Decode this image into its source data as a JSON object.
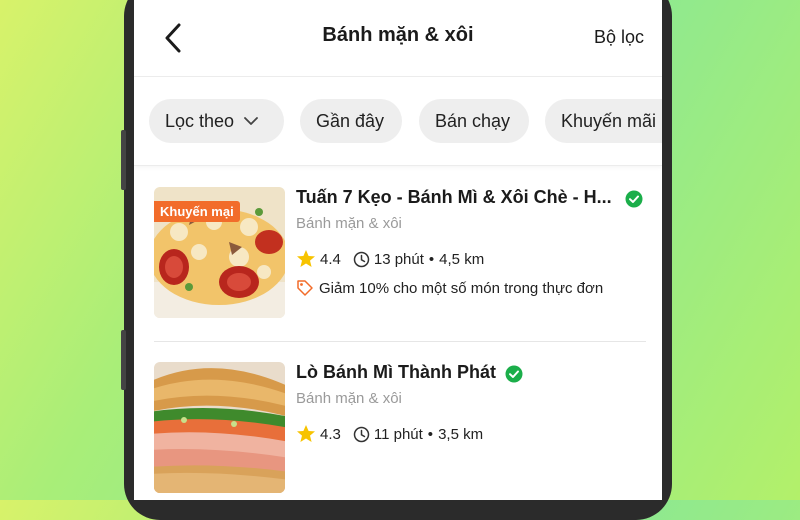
{
  "header": {
    "title": "Bánh mặn & xôi",
    "filter_label": "Bộ lọc"
  },
  "chips": [
    {
      "label": "Lọc theo"
    },
    {
      "label": "Gần đây"
    },
    {
      "label": "Bán chạy"
    },
    {
      "label": "Khuyến mãi"
    }
  ],
  "restaurants": [
    {
      "name": "Tuấn 7 Kẹo - Bánh Mì & Xôi Chè - H...",
      "category": "Bánh mặn & xôi",
      "rating": "4.4",
      "time": "13 phút",
      "separator": "•",
      "distance": "4,5 km",
      "badge": "Khuyến mại",
      "promo": "Giảm 10% cho một số món trong thực đơn",
      "verified": true
    },
    {
      "name": "Lò Bánh Mì Thành Phát",
      "category": "Bánh mặn & xôi",
      "rating": "4.3",
      "time": "11 phút",
      "separator": "•",
      "distance": "3,5 km",
      "verified": true
    }
  ],
  "colors": {
    "verified_green": "#1bae4a",
    "badge_orange": "#f26c2a",
    "star_yellow": "#f7c300"
  },
  "icons": [
    "back-arrow-icon",
    "chevron-down-icon",
    "verified-check-icon",
    "star-icon",
    "clock-icon",
    "tag-icon"
  ]
}
